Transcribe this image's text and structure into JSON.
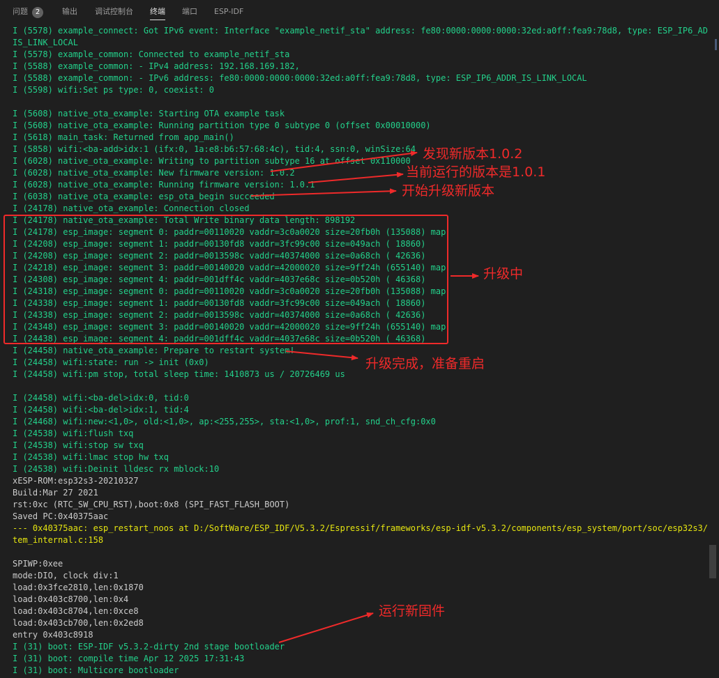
{
  "tabs": [
    {
      "label": "问题",
      "badge": "2"
    },
    {
      "label": "输出"
    },
    {
      "label": "调试控制台"
    },
    {
      "label": "终端"
    },
    {
      "label": "端口"
    },
    {
      "label": "ESP-IDF"
    }
  ],
  "terminal": {
    "lines": [
      {
        "text": "I (5578) example_connect: Got IPv6 event: Interface \"example_netif_sta\" address: fe80:0000:0000:0000:32ed:a0ff:fea9:78d8, type: ESP_IP6_ADDR_",
        "kind": "info"
      },
      {
        "text": "IS_LINK_LOCAL",
        "kind": "info"
      },
      {
        "text": "I (5578) example_common: Connected to example_netif_sta",
        "kind": "info"
      },
      {
        "text": "I (5588) example_common: - IPv4 address: 192.168.169.182,",
        "kind": "info"
      },
      {
        "text": "I (5588) example_common: - IPv6 address: fe80:0000:0000:0000:32ed:a0ff:fea9:78d8, type: ESP_IP6_ADDR_IS_LINK_LOCAL",
        "kind": "info"
      },
      {
        "text": "I (5598) wifi:Set ps type: 0, coexist: 0",
        "kind": "info"
      },
      {
        "text": "",
        "kind": "plain"
      },
      {
        "text": "I (5608) native_ota_example: Starting OTA example task",
        "kind": "info"
      },
      {
        "text": "I (5608) native_ota_example: Running partition type 0 subtype 0 (offset 0x00010000)",
        "kind": "info"
      },
      {
        "text": "I (5618) main_task: Returned from app_main()",
        "kind": "info"
      },
      {
        "text": "I (5858) wifi:<ba-add>idx:1 (ifx:0, 1a:e8:b6:57:68:4c), tid:4, ssn:0, winSize:64",
        "kind": "info"
      },
      {
        "text": "I (6028) native_ota_example: Writing to partition subtype 16 at offset 0x110000",
        "kind": "info"
      },
      {
        "text": "I (6028) native_ota_example: New firmware version: 1.0.2",
        "kind": "info"
      },
      {
        "text": "I (6028) native_ota_example: Running firmware version: 1.0.1",
        "kind": "info"
      },
      {
        "text": "I (6038) native_ota_example: esp_ota_begin succeeded",
        "kind": "info"
      },
      {
        "text": "I (24178) native_ota_example: Connection closed",
        "kind": "info"
      },
      {
        "text": "I (24178) native_ota_example: Total Write binary data length: 898192",
        "kind": "info"
      },
      {
        "text": "I (24178) esp_image: segment 0: paddr=00110020 vaddr=3c0a0020 size=20fb0h (135088) map",
        "kind": "info"
      },
      {
        "text": "I (24208) esp_image: segment 1: paddr=00130fd8 vaddr=3fc99c00 size=049ach ( 18860)",
        "kind": "info"
      },
      {
        "text": "I (24208) esp_image: segment 2: paddr=0013598c vaddr=40374000 size=0a68ch ( 42636)",
        "kind": "info"
      },
      {
        "text": "I (24218) esp_image: segment 3: paddr=00140020 vaddr=42000020 size=9ff24h (655140) map",
        "kind": "info"
      },
      {
        "text": "I (24308) esp_image: segment 4: paddr=001dff4c vaddr=4037e68c size=0b520h ( 46368)",
        "kind": "info"
      },
      {
        "text": "I (24318) esp_image: segment 0: paddr=00110020 vaddr=3c0a0020 size=20fb0h (135088) map",
        "kind": "info"
      },
      {
        "text": "I (24338) esp_image: segment 1: paddr=00130fd8 vaddr=3fc99c00 size=049ach ( 18860)",
        "kind": "info"
      },
      {
        "text": "I (24338) esp_image: segment 2: paddr=0013598c vaddr=40374000 size=0a68ch ( 42636)",
        "kind": "info"
      },
      {
        "text": "I (24348) esp_image: segment 3: paddr=00140020 vaddr=42000020 size=9ff24h (655140) map",
        "kind": "info"
      },
      {
        "text": "I (24438) esp_image: segment 4: paddr=001dff4c vaddr=4037e68c size=0b520h ( 46368)",
        "kind": "info"
      },
      {
        "text": "I (24458) native_ota_example: Prepare to restart system!",
        "kind": "info"
      },
      {
        "text": "I (24458) wifi:state: run -> init (0x0)",
        "kind": "info"
      },
      {
        "text": "I (24458) wifi:pm stop, total sleep time: 1410873 us / 20726469 us",
        "kind": "info"
      },
      {
        "text": "",
        "kind": "plain"
      },
      {
        "text": "I (24458) wifi:<ba-del>idx:0, tid:0",
        "kind": "info"
      },
      {
        "text": "I (24458) wifi:<ba-del>idx:1, tid:4",
        "kind": "info"
      },
      {
        "text": "I (24468) wifi:new:<1,0>, old:<1,0>, ap:<255,255>, sta:<1,0>, prof:1, snd_ch_cfg:0x0",
        "kind": "info"
      },
      {
        "text": "I (24538) wifi:flush txq",
        "kind": "info"
      },
      {
        "text": "I (24538) wifi:stop sw txq",
        "kind": "info"
      },
      {
        "text": "I (24538) wifi:lmac stop hw txq",
        "kind": "info"
      },
      {
        "text": "I (24538) wifi:Deinit lldesc rx mblock:10",
        "kind": "info"
      },
      {
        "text": "xESP-ROM:esp32s3-20210327",
        "kind": "plain"
      },
      {
        "text": "Build:Mar 27 2021",
        "kind": "plain"
      },
      {
        "text": "rst:0xc (RTC_SW_CPU_RST),boot:0x8 (SPI_FAST_FLASH_BOOT)",
        "kind": "plain"
      },
      {
        "text": "Saved PC:0x40375aac",
        "kind": "plain"
      },
      {
        "text": "--- 0x40375aac: esp_restart_noos at D:/SoftWare/ESP_IDF/V5.3.2/Espressif/frameworks/esp-idf-v5.3.2/components/esp_system/port/soc/esp32s3/sys",
        "kind": "warn"
      },
      {
        "text": "tem_internal.c:158",
        "kind": "warn"
      },
      {
        "text": "",
        "kind": "plain"
      },
      {
        "text": "SPIWP:0xee",
        "kind": "plain"
      },
      {
        "text": "mode:DIO, clock div:1",
        "kind": "plain"
      },
      {
        "text": "load:0x3fce2810,len:0x1870",
        "kind": "plain"
      },
      {
        "text": "load:0x403c8700,len:0x4",
        "kind": "plain"
      },
      {
        "text": "load:0x403c8704,len:0xce8",
        "kind": "plain"
      },
      {
        "text": "load:0x403cb700,len:0x2ed8",
        "kind": "plain"
      },
      {
        "text": "entry 0x403c8918",
        "kind": "plain"
      },
      {
        "text": "I (31) boot: ESP-IDF v5.3.2-dirty 2nd stage bootloader",
        "kind": "info"
      },
      {
        "text": "I (31) boot: compile time Apr 12 2025 17:31:43",
        "kind": "info"
      },
      {
        "text": "I (31) boot: Multicore bootloader",
        "kind": "info"
      }
    ]
  },
  "annotations": {
    "new_version_found": "发现新版本1.0.2",
    "current_version": "当前运行的版本是1.0.1",
    "start_upgrade": "开始升级新版本",
    "upgrading": "升级中",
    "upgrade_done": "升级完成，准备重启",
    "run_new_firmware": "运行新固件"
  },
  "colors": {
    "background": "#1f1f1f",
    "info_text": "#23d18b",
    "plain_text": "#cccccc",
    "warn_text": "#e5e510",
    "annotation": "#ef2a2a"
  }
}
